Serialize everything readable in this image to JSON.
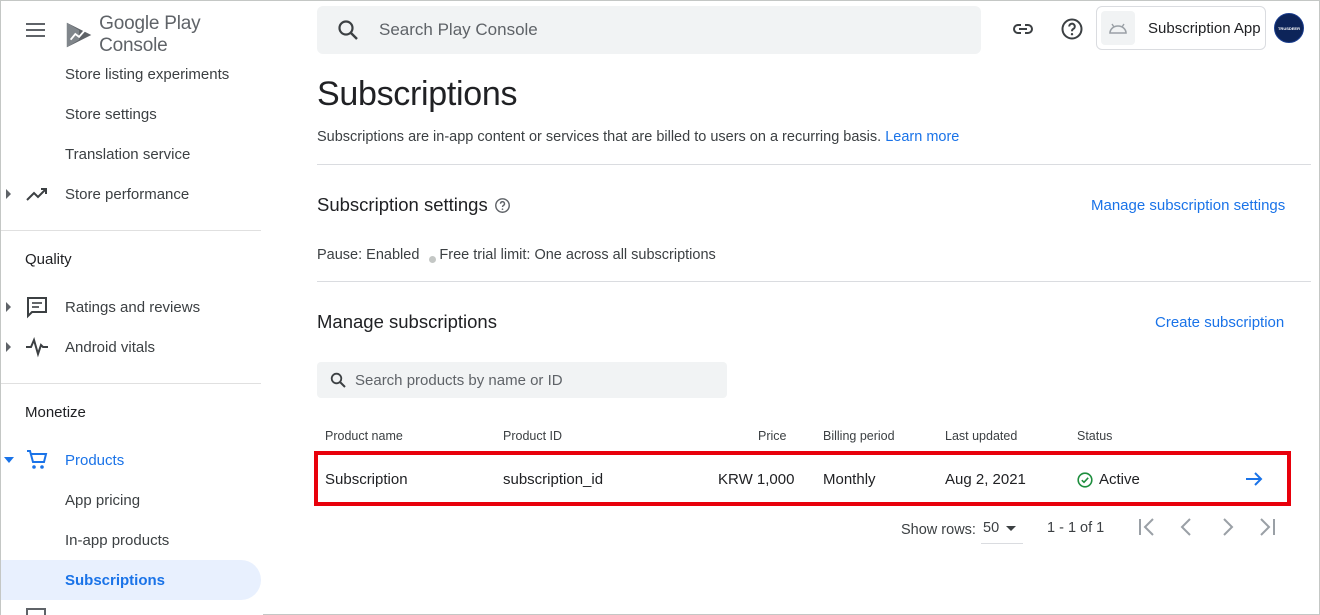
{
  "header": {
    "logo_text": "Google Play Console",
    "search_placeholder": "Search Play Console",
    "app_name": "Subscription App",
    "avatar_text": "TRUSDEER"
  },
  "sidebar": {
    "items_top": [
      {
        "label": "Store listing experiments"
      },
      {
        "label": "Store settings"
      },
      {
        "label": "Translation service"
      },
      {
        "label": "Store performance"
      }
    ],
    "quality": {
      "title": "Quality",
      "items": [
        {
          "label": "Ratings and reviews"
        },
        {
          "label": "Android vitals"
        }
      ]
    },
    "monetize": {
      "title": "Monetize",
      "products_label": "Products",
      "items": [
        {
          "label": "App pricing"
        },
        {
          "label": "In-app products"
        },
        {
          "label": "Subscriptions"
        }
      ]
    }
  },
  "main": {
    "title": "Subscriptions",
    "description": "Subscriptions are in-app content or services that are billed to users on a recurring basis.",
    "learn_more": "Learn more",
    "settings": {
      "heading": "Subscription settings",
      "manage_link": "Manage subscription settings",
      "pause": "Pause: Enabled",
      "free_trial": "Free trial limit: One across all subscriptions"
    },
    "manage": {
      "heading": "Manage subscriptions",
      "create_link": "Create subscription",
      "search_placeholder": "Search products by name or ID"
    },
    "table": {
      "columns": [
        "Product name",
        "Product ID",
        "Price",
        "Billing period",
        "Last updated",
        "Status"
      ],
      "rows": [
        {
          "name": "Subscription",
          "id": "subscription_id",
          "price": "KRW 1,000",
          "billing": "Monthly",
          "updated": "Aug 2, 2021",
          "status": "Active"
        }
      ]
    },
    "pagination": {
      "show_rows_label": "Show rows:",
      "rows_value": "50",
      "range": "1 - 1 of 1"
    }
  },
  "colors": {
    "accent": "#1a73e8",
    "highlight_border": "#e8000b",
    "active_status": "#1e8e3e"
  }
}
